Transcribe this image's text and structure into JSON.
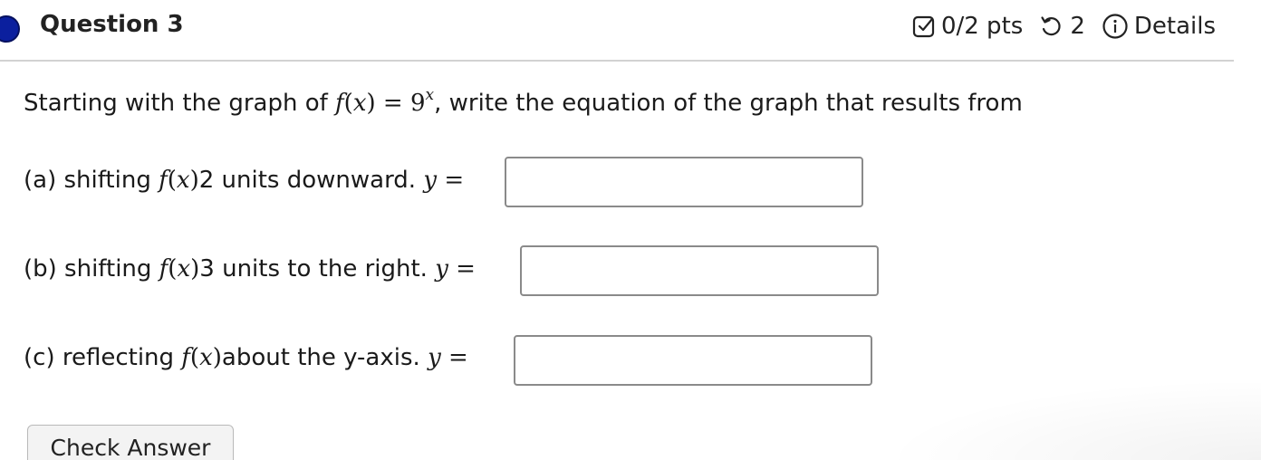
{
  "header": {
    "title": "Question 3",
    "points": "0/2 pts",
    "attempts": "2",
    "details_label": "Details",
    "icons": {
      "status": "question-status-dot-icon",
      "points": "checkbox-icon",
      "attempts": "retry-icon",
      "details": "info-icon"
    },
    "colors": {
      "status_dot": "#0b1f9e"
    }
  },
  "question": {
    "prefix": "Starting with the graph of",
    "f": "f",
    "lparen": "(",
    "x": "x",
    "rparen": ")",
    "equals": "=",
    "base": "9",
    "exponent": "x",
    "suffix": ", write the equation of the graph that results from",
    "parts": [
      {
        "label": "(a) shifting",
        "mid": " 2 units downward.",
        "y": "y",
        "eq": "="
      },
      {
        "label": "(b) shifting",
        "mid": " 3 units to the right.",
        "y": "y",
        "eq": "="
      },
      {
        "label": "(c) reflecting",
        "mid": " about the y-axis.",
        "y": "y",
        "eq": "="
      }
    ]
  },
  "answers": [
    {
      "value": ""
    },
    {
      "value": ""
    },
    {
      "value": ""
    }
  ],
  "actions": {
    "check_answer": "Check Answer"
  }
}
